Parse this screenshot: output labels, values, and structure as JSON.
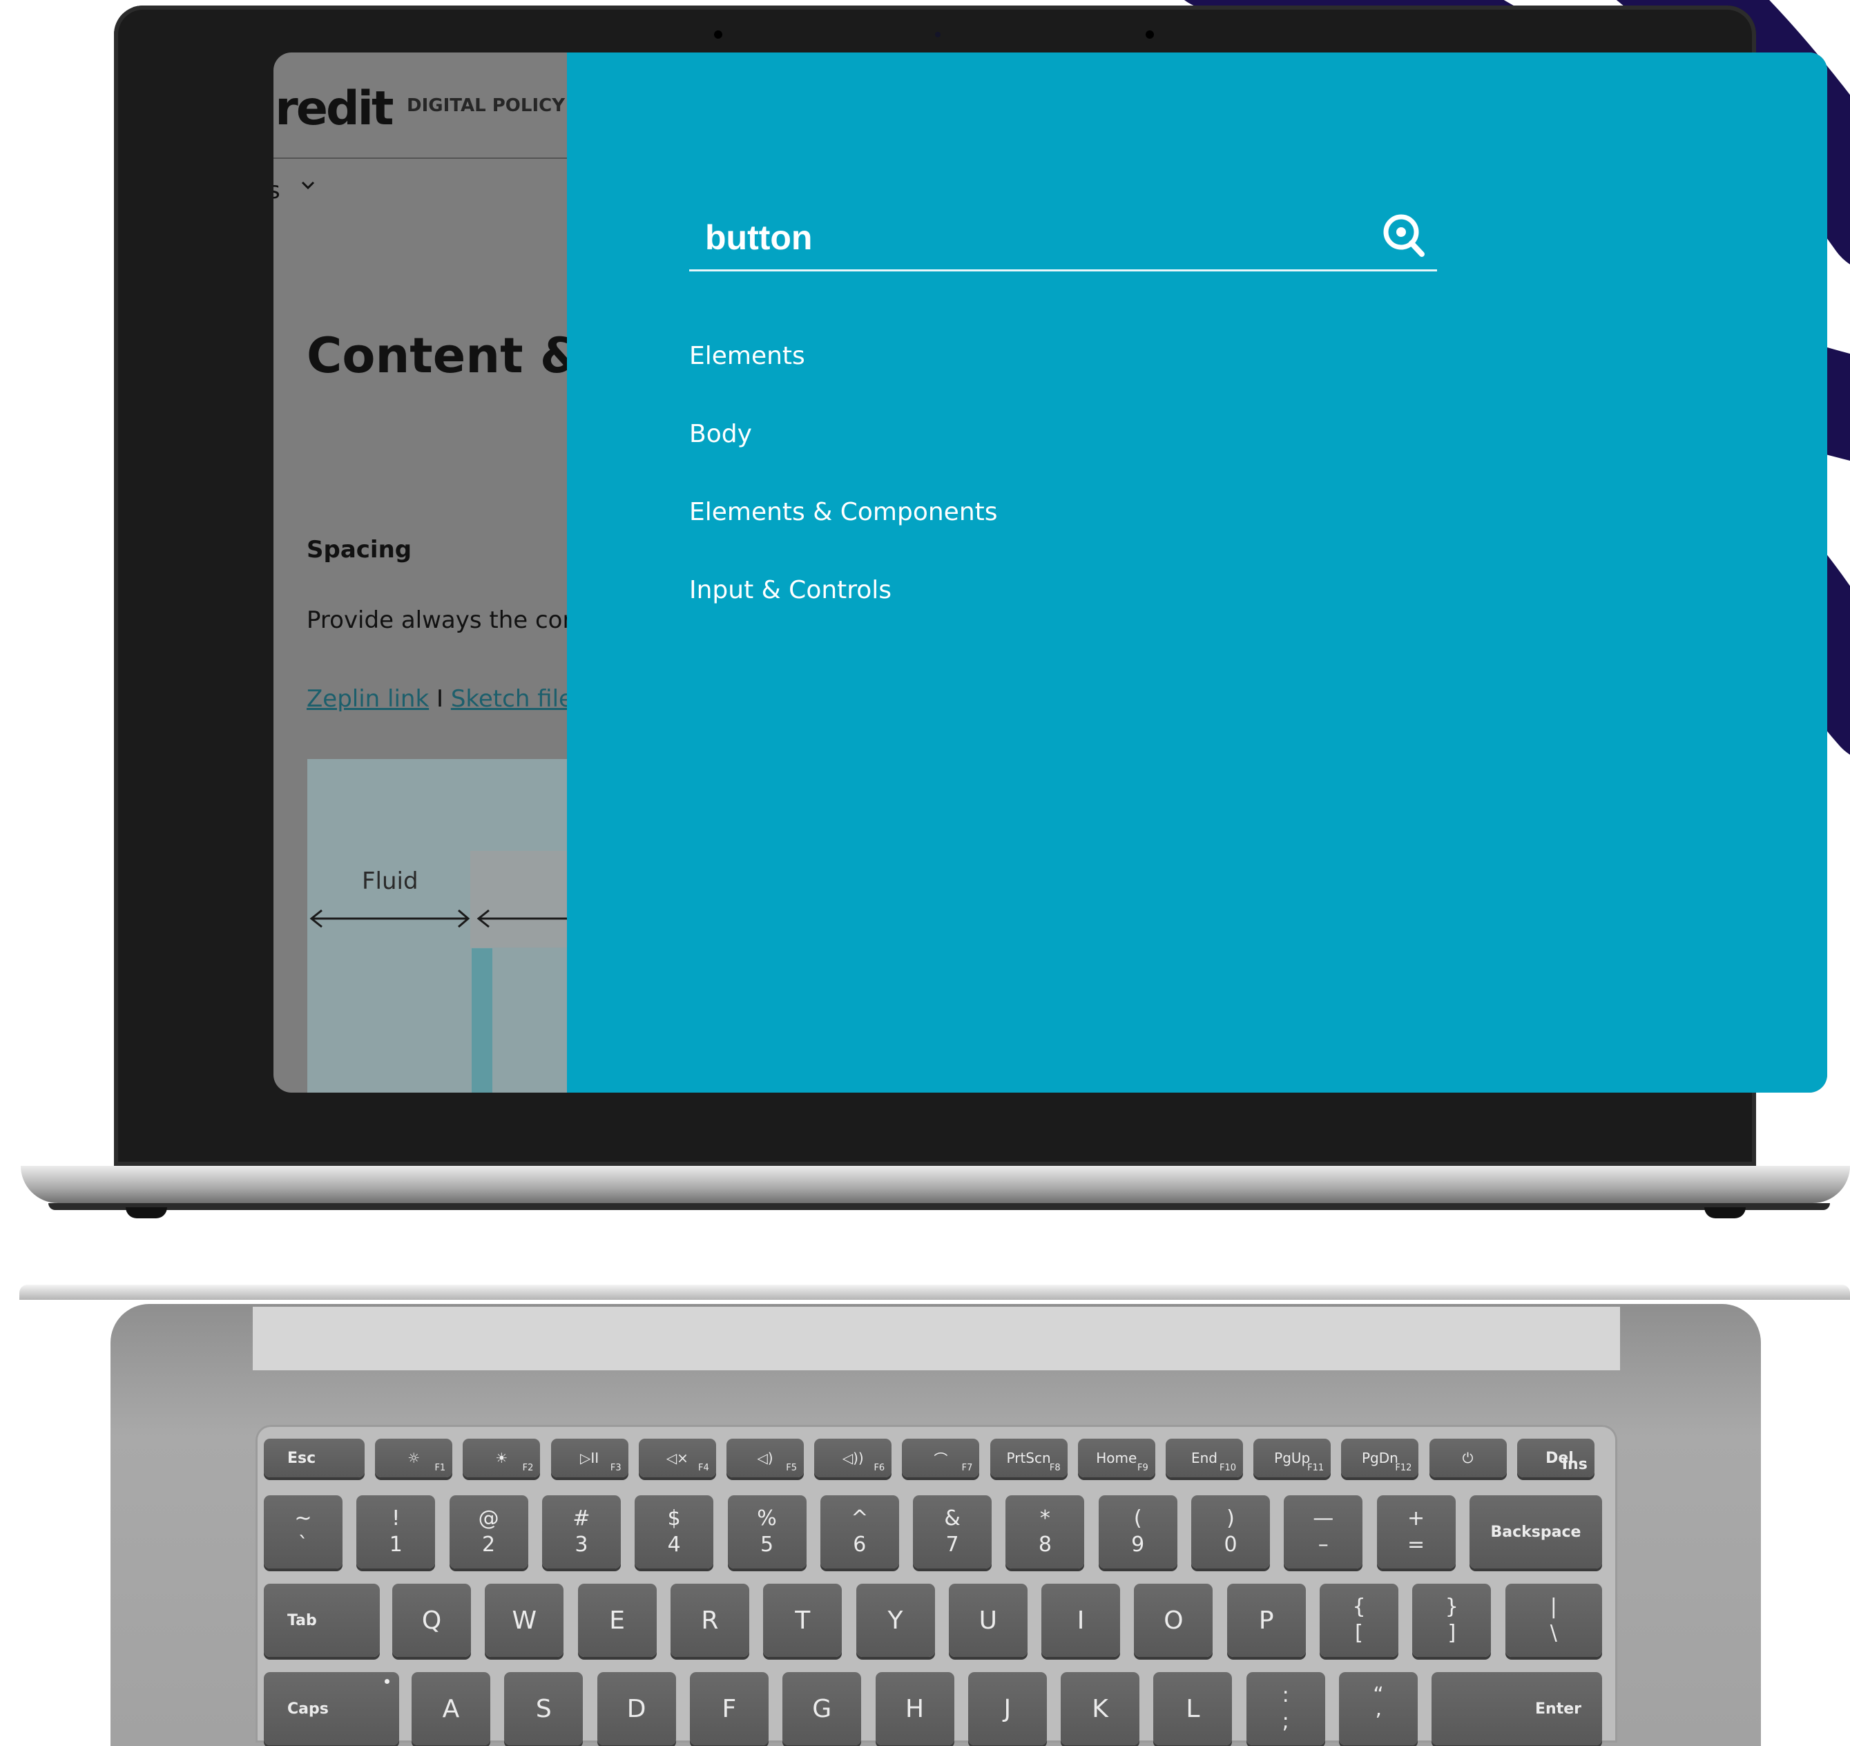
{
  "background_site": {
    "logo_text": "iredit",
    "nav_label": "DIGITAL POLICY",
    "nav_dropdown_text": "s",
    "page_title": "Content & C",
    "section_heading": "Spacing",
    "paragraph": "Provide always the corre",
    "link_zeplin": "Zeplin link",
    "link_separator": "I",
    "link_sketch": "Sketch file",
    "diagram_label": "Fluid"
  },
  "search": {
    "query": "button",
    "icon": "search-icon",
    "results": [
      "Elements",
      "Body",
      "Elements & Components",
      "Input & Controls"
    ]
  },
  "keyboard": {
    "function_row": [
      {
        "main": "Esc",
        "sub": ""
      },
      {
        "main": "☼",
        "sub": "F1"
      },
      {
        "main": "☀",
        "sub": "F2"
      },
      {
        "main": "▷II",
        "sub": "F3"
      },
      {
        "main": "◁×",
        "sub": "F4"
      },
      {
        "main": "◁)",
        "sub": "F5"
      },
      {
        "main": "◁))",
        "sub": "F6"
      },
      {
        "main": "⌒",
        "sub": "F7"
      },
      {
        "main": "PrtScn",
        "sub": "F8"
      },
      {
        "main": "Home",
        "sub": "F9"
      },
      {
        "main": "End",
        "sub": "F10"
      },
      {
        "main": "PgUp",
        "sub": "F11"
      },
      {
        "main": "PgDn",
        "sub": "F12"
      },
      {
        "main": "⏻",
        "sub": ""
      },
      {
        "main": "Del",
        "sub": "Ins"
      }
    ],
    "number_row": [
      {
        "top": "~",
        "bot": "`"
      },
      {
        "top": "!",
        "bot": "1"
      },
      {
        "top": "@",
        "bot": "2"
      },
      {
        "top": "#",
        "bot": "3"
      },
      {
        "top": "$",
        "bot": "4"
      },
      {
        "top": "%",
        "bot": "5"
      },
      {
        "top": "^",
        "bot": "6"
      },
      {
        "top": "&",
        "bot": "7"
      },
      {
        "top": "*",
        "bot": "8"
      },
      {
        "top": "(",
        "bot": "9"
      },
      {
        "top": ")",
        "bot": "0"
      },
      {
        "top": "—",
        "bot": "–"
      },
      {
        "top": "+",
        "bot": "="
      }
    ],
    "backspace": "Backspace",
    "tab": "Tab",
    "qwerty_row": [
      "Q",
      "W",
      "E",
      "R",
      "T",
      "Y",
      "U",
      "I",
      "O",
      "P"
    ],
    "bracket_keys": [
      {
        "top": "{",
        "bot": "["
      },
      {
        "top": "}",
        "bot": "]"
      },
      {
        "top": "|",
        "bot": "\\"
      }
    ],
    "caps": "Caps",
    "home_row": [
      "A",
      "S",
      "D",
      "F",
      "G",
      "H",
      "J",
      "K",
      "L"
    ],
    "punct_keys": [
      {
        "top": ":",
        "bot": ";"
      },
      {
        "top": "“",
        "bot": "’"
      }
    ],
    "enter": "Enter"
  },
  "colors": {
    "overlay": "#03a3c3",
    "wave": "#1a0f4f",
    "link": "#1c5f6c"
  }
}
